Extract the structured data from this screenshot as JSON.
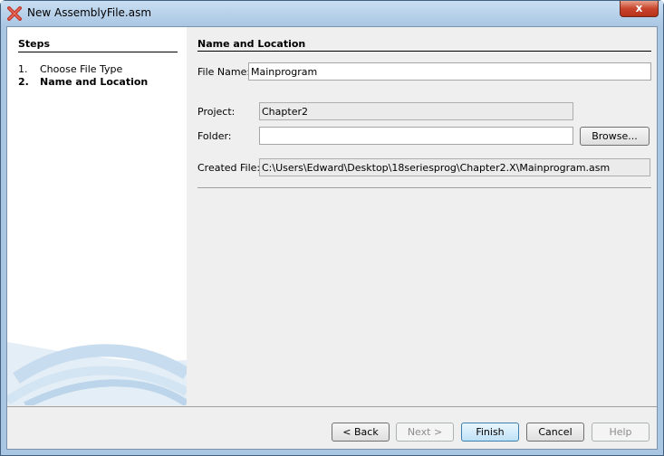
{
  "window": {
    "title": "New AssemblyFile.asm",
    "close_glyph": "x"
  },
  "steps": {
    "title": "Steps",
    "items": [
      {
        "num": "1.",
        "label": "Choose File Type"
      },
      {
        "num": "2.",
        "label": "Name and Location"
      }
    ]
  },
  "main": {
    "title": "Name and Location",
    "file_name_label": "File Name:",
    "file_name_value": "Mainprogram",
    "project_label": "Project:",
    "project_value": "Chapter2",
    "folder_label": "Folder:",
    "folder_value": "",
    "browse_label": "Browse...",
    "created_file_label": "Created File:",
    "created_file_value": "C:\\Users\\Edward\\Desktop\\18seriesprog\\Chapter2.X\\Mainprogram.asm"
  },
  "buttons": {
    "back": "< Back",
    "next": "Next >",
    "finish": "Finish",
    "cancel": "Cancel",
    "help": "Help"
  }
}
